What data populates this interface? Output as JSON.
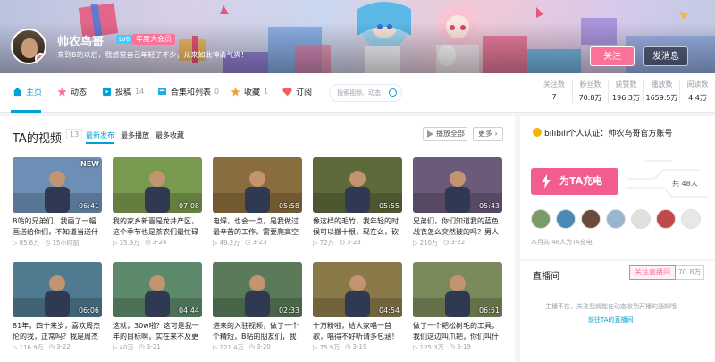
{
  "header": {
    "username": "帅农鸟哥",
    "level": "LV6",
    "vip_badge": "年度大会员",
    "signature": "来到B站以后，我感觉自己年轻了不少，从来如此神清气爽！",
    "follow_label": "关注",
    "message_label": "发消息"
  },
  "nav": {
    "tabs": [
      {
        "label": "主页",
        "count": ""
      },
      {
        "label": "动态",
        "count": ""
      },
      {
        "label": "投稿",
        "count": "14"
      },
      {
        "label": "合集和列表",
        "count": "0"
      },
      {
        "label": "收藏",
        "count": "1"
      },
      {
        "label": "订阅",
        "count": ""
      }
    ],
    "search_placeholder": "搜索视频、动态",
    "stats": [
      {
        "label": "关注数",
        "value": "7"
      },
      {
        "label": "粉丝数",
        "value": "70.8万"
      },
      {
        "label": "获赞数",
        "value": "196.3万"
      },
      {
        "label": "播放数",
        "value": "1659.5万"
      },
      {
        "label": "阅读数",
        "value": "4.4万"
      }
    ]
  },
  "videos_section": {
    "title": "TA的视频",
    "count": "13",
    "sort_options": [
      "最新发布",
      "最多播放",
      "最多收藏"
    ],
    "play_all_label": "播放全部",
    "more_label": "更多",
    "items": [
      {
        "title": "B站的兄弟们，我画了一幅画送给你们，不知道当送什么",
        "duration": "06:41",
        "badge": "NEW",
        "plays": "85.6万",
        "date": "15小时前",
        "bg": "#6d8fb5"
      },
      {
        "title": "我的家乡新晋是龙井产区，这个季节也是茶农们最忙碌的时",
        "duration": "07:08",
        "badge": "",
        "plays": "35.9万",
        "date": "3-24",
        "bg": "#7a9a4f"
      },
      {
        "title": "电焊，也会一点，是我做过最辛苦的工作。需要爬高空钢",
        "duration": "05:58",
        "badge": "",
        "plays": "49.2万",
        "date": "3-23",
        "bg": "#8a6d3e"
      },
      {
        "title": "像这样的毛竹，我年轻的时候可以搬十根，现在么，砍柴刀",
        "duration": "05:55",
        "badge": "",
        "plays": "72万",
        "date": "3-23",
        "bg": "#5f6a3a"
      },
      {
        "title": "兄弟们，你们知道我的蓝色战衣怎么突然破的吗？男人有的时",
        "duration": "05:43",
        "badge": "",
        "plays": "210万",
        "date": "3-22",
        "bg": "#6b5a7a"
      },
      {
        "title": "81年，四十来岁，喜欢周杰伦的我，正常吗？我是周杰伦的",
        "duration": "06:06",
        "badge": "",
        "plays": "116.9万",
        "date": "3-22",
        "bg": "#4f7a8f"
      },
      {
        "title": "这就，30w啦？这可是我一年的目标啊，实在来不及更新，",
        "duration": "04:44",
        "badge": "",
        "plays": "40万",
        "date": "3-21",
        "bg": "#5d8a6a"
      },
      {
        "title": "进来的入驻视频，做了一个个精短，B站的朋友们，我舞起",
        "duration": "02:33",
        "badge": "",
        "plays": "121.4万",
        "date": "3-20",
        "bg": "#5a7a5a"
      },
      {
        "title": "十万粉啦，给大家唱一首歌，唱得不好听请多包涵！（视频",
        "duration": "04:54",
        "badge": "",
        "plays": "75.9万",
        "date": "3-19",
        "bg": "#8a7a4a"
      },
      {
        "title": "做了一个耙松树毛的工具，我们这边叫爪耙，你们叫什么？",
        "duration": "06:51",
        "badge": "",
        "plays": "125.3万",
        "date": "3-19",
        "bg": "#7a8a5a"
      }
    ]
  },
  "sidebar": {
    "certification": "bilibili个人认证：帅农鸟哥官方账号",
    "charge_label": "为TA充电",
    "charge_count": "共 48人",
    "charge_month_text": "本月共 48人为TA充电",
    "fan_colors": [
      "#7a9a6a",
      "#4a8ab5",
      "#6a4a3a",
      "#9ab5d0",
      "#e0e0e0",
      "#c04a4a",
      "#e8e8e8"
    ]
  },
  "live": {
    "title": "直播间",
    "follow_live_label": "关注直播间",
    "follow_live_count": "70.8万",
    "status_text": "主播不在，关注我就能在动态收到开播的通知哦",
    "link_text": "前往TA的直播间"
  },
  "colors": {
    "accent_blue": "#00a1d6",
    "accent_pink": "#fb7299"
  }
}
